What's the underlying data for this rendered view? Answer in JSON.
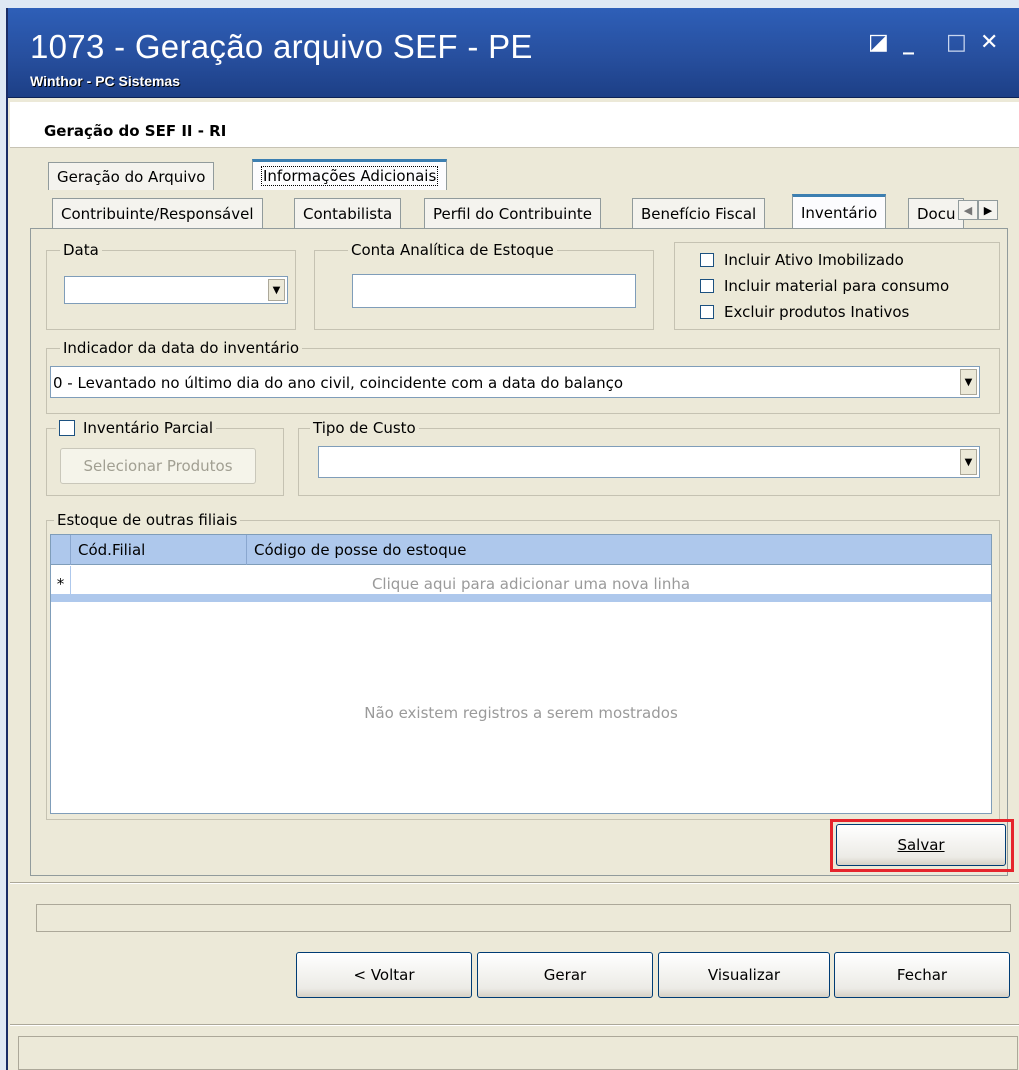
{
  "window": {
    "title": "1073 - Geração arquivo SEF - PE",
    "subtitle": "Winthor - PC Sistemas",
    "controls": [
      "◪",
      "_",
      "□",
      "✕"
    ]
  },
  "header": {
    "title": "Geração do SEF II - RI"
  },
  "top_tabs": [
    {
      "label": "Geração do Arquivo",
      "active": false
    },
    {
      "label": "Informações Adicionais",
      "active": true
    }
  ],
  "sub_tabs": [
    {
      "label": "Contribuinte/Responsável",
      "active": false
    },
    {
      "label": "Contabilista",
      "active": false
    },
    {
      "label": "Perfil do Contribuinte",
      "active": false
    },
    {
      "label": "Benefício Fiscal",
      "active": false
    },
    {
      "label": "Inventário",
      "active": true
    },
    {
      "label": "Docu",
      "active": false
    }
  ],
  "scroll_arrows": {
    "left": "◀",
    "right": "▶"
  },
  "form": {
    "data_label": "Data",
    "data_value": "",
    "conta_label": "Conta Analítica de Estoque",
    "conta_value": "",
    "checkboxes": [
      {
        "label": "Incluir Ativo Imobilizado",
        "checked": false
      },
      {
        "label": "Incluir material para consumo",
        "checked": false
      },
      {
        "label": "Excluir produtos Inativos",
        "checked": false
      }
    ],
    "indicador_label": "Indicador da data do inventário",
    "indicador_value": "0 - Levantado no último dia do ano civil, coincidente com a data do balanço",
    "parcial_label": "Inventário Parcial",
    "parcial_checked": false,
    "selecionar_label": "Selecionar Produtos",
    "tipo_custo_label": "Tipo de Custo",
    "tipo_custo_value": ""
  },
  "grid": {
    "group_label": "Estoque de outras filiais",
    "columns": [
      "Cód.Filial",
      "Código de posse do estoque"
    ],
    "new_row_marker": "*",
    "new_row_text": "Clique aqui para adicionar uma nova linha",
    "empty_text": "Não existem registros a serem mostrados"
  },
  "buttons": {
    "salvar": "Salvar",
    "voltar": "< Voltar",
    "gerar": "Gerar",
    "visualizar": "Visualizar",
    "fechar": "Fechar"
  },
  "colors": {
    "title_bar": "#274f9e",
    "highlight": "#e5242b",
    "grid_header": "#aec8ec"
  }
}
